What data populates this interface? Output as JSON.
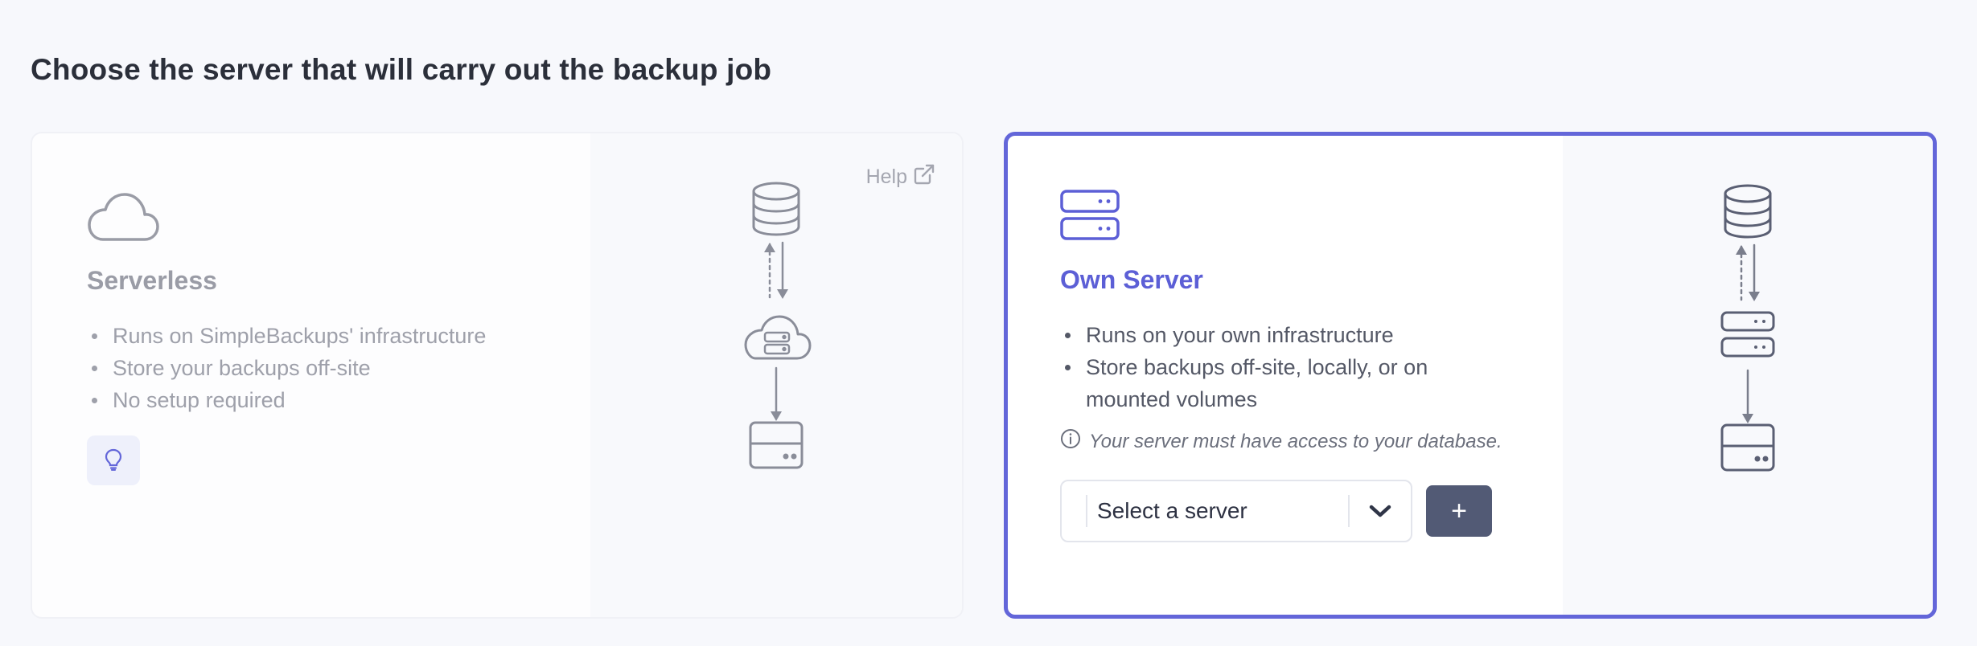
{
  "page": {
    "title": "Choose the server that will carry out the backup job"
  },
  "serverless": {
    "heading": "Serverless",
    "icon": "cloud-icon",
    "bullets": [
      "Runs on SimpleBackups' infrastructure",
      "Store your backups off-site",
      "No setup required"
    ],
    "tip_icon": "lightbulb-icon",
    "help_label": "Help",
    "help_icon": "external-link-icon"
  },
  "own_server": {
    "heading": "Own Server",
    "icon": "server-icon",
    "selected": true,
    "bullets": [
      "Runs on your own infrastructure",
      "Store backups off-site, locally, or on mounted volumes"
    ],
    "note": "Your server must have access to your database.",
    "note_icon": "info-icon",
    "select": {
      "value": "Select a server",
      "chevron_icon": "chevron-down-icon"
    },
    "add_button_label": "+"
  },
  "colors": {
    "accent": "#5c5fd6",
    "selected_border": "#6366d9",
    "muted_text": "#9ea0aa",
    "button_dark": "#525a75",
    "diagram_gray": "#8a8d99",
    "diagram_dark": "#5a5f73"
  }
}
